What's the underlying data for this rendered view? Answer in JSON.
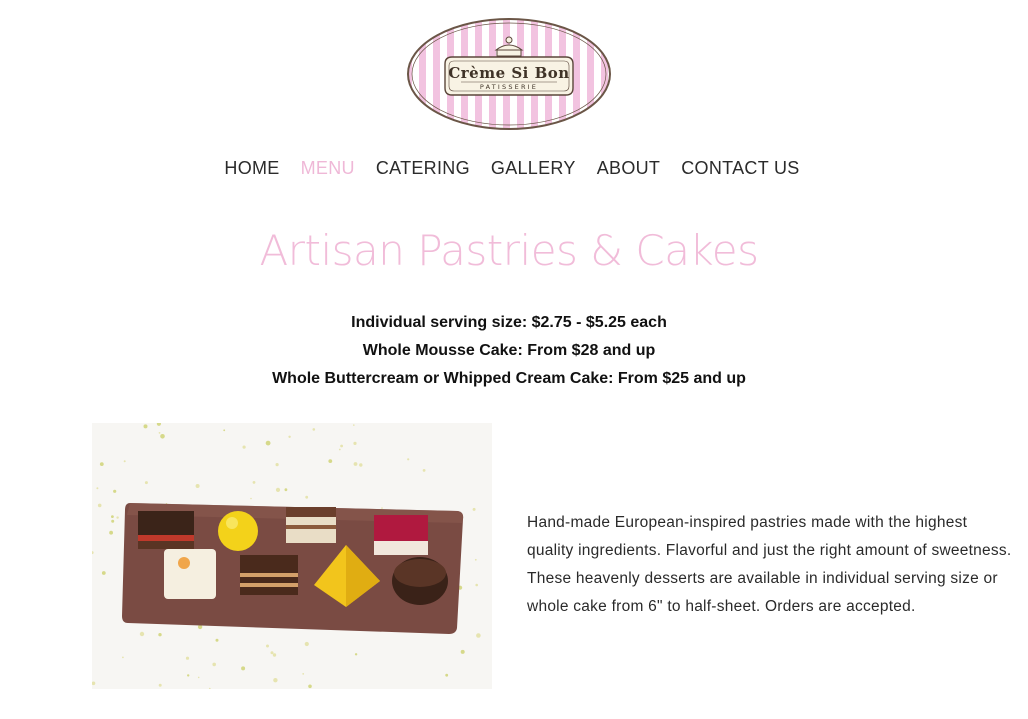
{
  "logo": {
    "name": "Crème Si Bon",
    "subtitle": "PATISSERIE"
  },
  "nav": {
    "items": [
      {
        "label": "HOME",
        "active": false
      },
      {
        "label": "MENU",
        "active": true
      },
      {
        "label": "CATERING",
        "active": false
      },
      {
        "label": "GALLERY",
        "active": false
      },
      {
        "label": "ABOUT",
        "active": false
      },
      {
        "label": "CONTACT US",
        "active": false
      }
    ]
  },
  "main": {
    "title": "Artisan Pastries & Cakes",
    "pricing": [
      "Individual serving size: $2.75 - $5.25 each",
      "Whole Mousse Cake: From $28 and up",
      "Whole Buttercream or Whipped Cream Cake: From $25 and up"
    ],
    "description": "Hand-made European-inspired pastries made with the highest quality ingredients. Flavorful and just the right amount of sweetness. These heavenly desserts are available in individual serving size or whole cake from 6\" to half-sheet. Orders are accepted."
  },
  "colors": {
    "accent_pink": "#f1bcd9",
    "logo_stripe_pink": "#f2c3e0",
    "logo_text": "#3f3327",
    "board_brown": "#7a4b43"
  }
}
